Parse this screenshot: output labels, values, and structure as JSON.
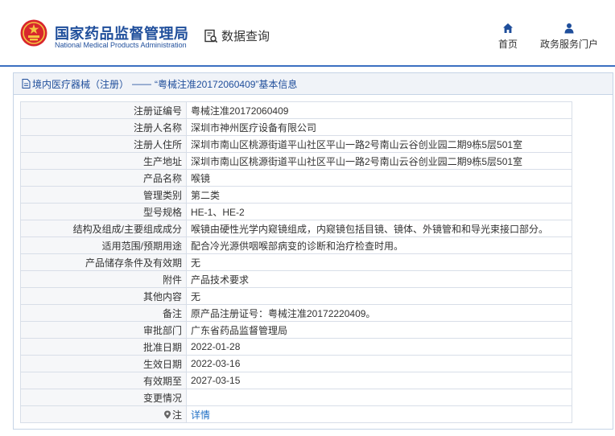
{
  "header": {
    "brand_cn": "国家药品监督管理局",
    "brand_en": "National Medical Products Administration",
    "query_label": "数据查询",
    "nav": {
      "home": "首页",
      "portal": "政务服务门户"
    }
  },
  "breadcrumb": {
    "category": "境内医疗器械（注册）",
    "separator": "——",
    "record": "“粤械注准20172060409”基本信息"
  },
  "fields": [
    {
      "label": "注册证编号",
      "value": "粤械注准20172060409"
    },
    {
      "label": "注册人名称",
      "value": "深圳市神州医疗设备有限公司"
    },
    {
      "label": "注册人住所",
      "value": "深圳市南山区桃源街道平山社区平山一路2号南山云谷创业园二期9栋5层501室"
    },
    {
      "label": "生产地址",
      "value": "深圳市南山区桃源街道平山社区平山一路2号南山云谷创业园二期9栋5层501室"
    },
    {
      "label": "产品名称",
      "value": "喉镜"
    },
    {
      "label": "管理类别",
      "value": "第二类"
    },
    {
      "label": "型号规格",
      "value": "HE-1、HE-2"
    },
    {
      "label": "结构及组成/主要组成成分",
      "value": "喉镜由硬性光学内窥镜组成，内窥镜包括目镜、镜体、外镜管和和导光束接口部分。"
    },
    {
      "label": "适用范围/预期用途",
      "value": "配合冷光源供咽喉部病变的诊断和治疗检查时用。"
    },
    {
      "label": "产品储存条件及有效期",
      "value": "无"
    },
    {
      "label": "附件",
      "value": "产品技术要求"
    },
    {
      "label": "其他内容",
      "value": "无"
    },
    {
      "label": "备注",
      "value": "原产品注册证号：粤械注准20172220409。"
    },
    {
      "label": "审批部门",
      "value": "广东省药品监督管理局"
    },
    {
      "label": "批准日期",
      "value": "2022-01-28"
    },
    {
      "label": "生效日期",
      "value": "2022-03-16"
    },
    {
      "label": "有效期至",
      "value": "2027-03-15"
    },
    {
      "label": "变更情况",
      "value": ""
    }
  ],
  "note_row": {
    "label": "注",
    "link": "详情"
  },
  "colors": {
    "brand": "#1f4e9b",
    "link": "#1f6fc5",
    "header_rule": "#3b6fc1"
  },
  "icons": {
    "emblem": "national-emblem-icon",
    "query": "document-search-icon",
    "home": "home-icon",
    "portal": "user-icon",
    "breadcrumb": "document-icon",
    "note": "map-pin-icon"
  }
}
